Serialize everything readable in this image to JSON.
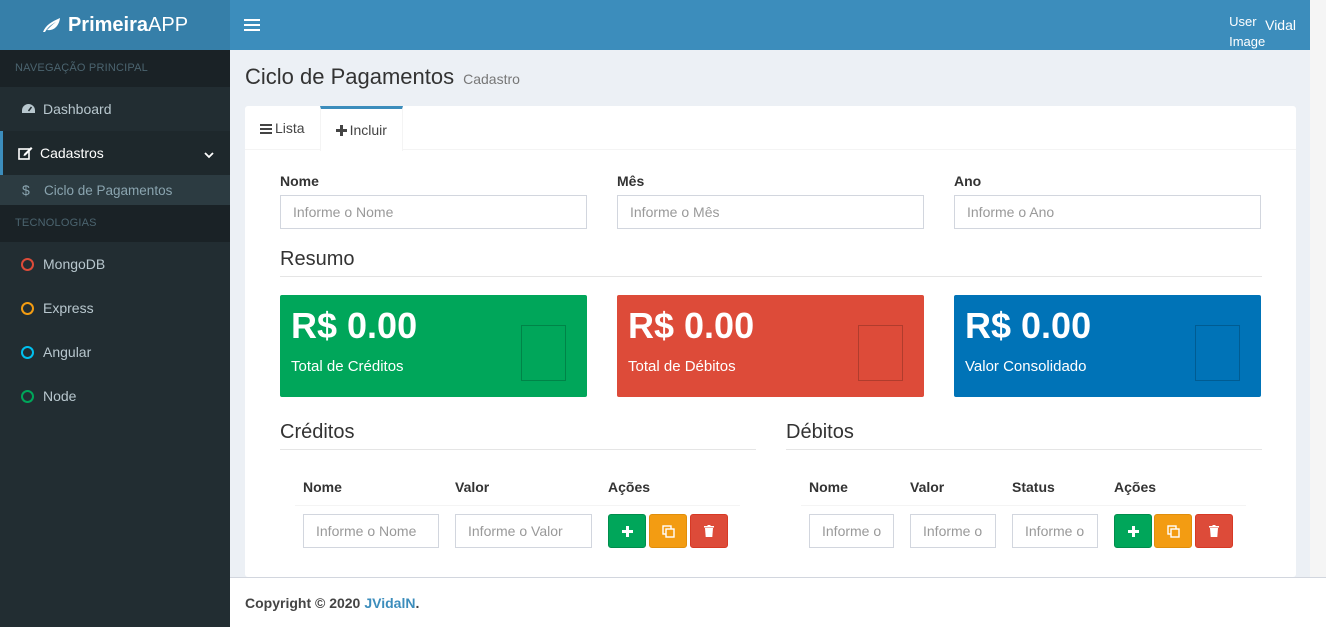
{
  "app": {
    "logo_bold": "Primeira",
    "logo_rest": "APP",
    "user_image_alt": "User Image",
    "user_name": "Vidal"
  },
  "sidebar": {
    "header_main": "NAVEGAÇÃO PRINCIPAL",
    "header_tech": "TECNOLOGIAS",
    "items": [
      {
        "label": "Dashboard",
        "icon": "dashboard-icon"
      },
      {
        "label": "Cadastros",
        "icon": "edit-icon"
      },
      {
        "label": "Ciclo de Pagamentos",
        "icon": "dollar-icon"
      }
    ],
    "tech": [
      {
        "label": "MongoDB",
        "color": "#dd4b39"
      },
      {
        "label": "Express",
        "color": "#f39c12"
      },
      {
        "label": "Angular",
        "color": "#00c0ef"
      },
      {
        "label": "Node",
        "color": "#00a65a"
      }
    ]
  },
  "page": {
    "title": "Ciclo de Pagamentos",
    "subtitle": "Cadastro"
  },
  "tabs": {
    "list": "Lista",
    "include": "Incluir"
  },
  "form": {
    "nome_label": "Nome",
    "nome_placeholder": "Informe o Nome",
    "mes_label": "Mês",
    "mes_placeholder": "Informe o Mês",
    "ano_label": "Ano",
    "ano_placeholder": "Informe o Ano"
  },
  "summary": {
    "legend": "Resumo",
    "credits_value": "R$ 0.00",
    "credits_label": "Total de Créditos",
    "debits_value": "R$ 0.00",
    "debits_label": "Total de Débitos",
    "consolidated_value": "R$ 0.00",
    "consolidated_label": "Valor Consolidado"
  },
  "credits": {
    "legend": "Créditos",
    "col_name": "Nome",
    "col_value": "Valor",
    "col_actions": "Ações",
    "name_placeholder": "Informe o Nome",
    "value_placeholder": "Informe o Valor"
  },
  "debits": {
    "legend": "Débitos",
    "col_name": "Nome",
    "col_value": "Valor",
    "col_status": "Status",
    "col_actions": "Ações",
    "name_placeholder": "Informe o Nome",
    "value_placeholder": "Informe o Valor",
    "status_placeholder": "Informe o Status"
  },
  "footer": {
    "copyright": "Copyright © 2020",
    "author": "JVidalN",
    "dot": "."
  }
}
